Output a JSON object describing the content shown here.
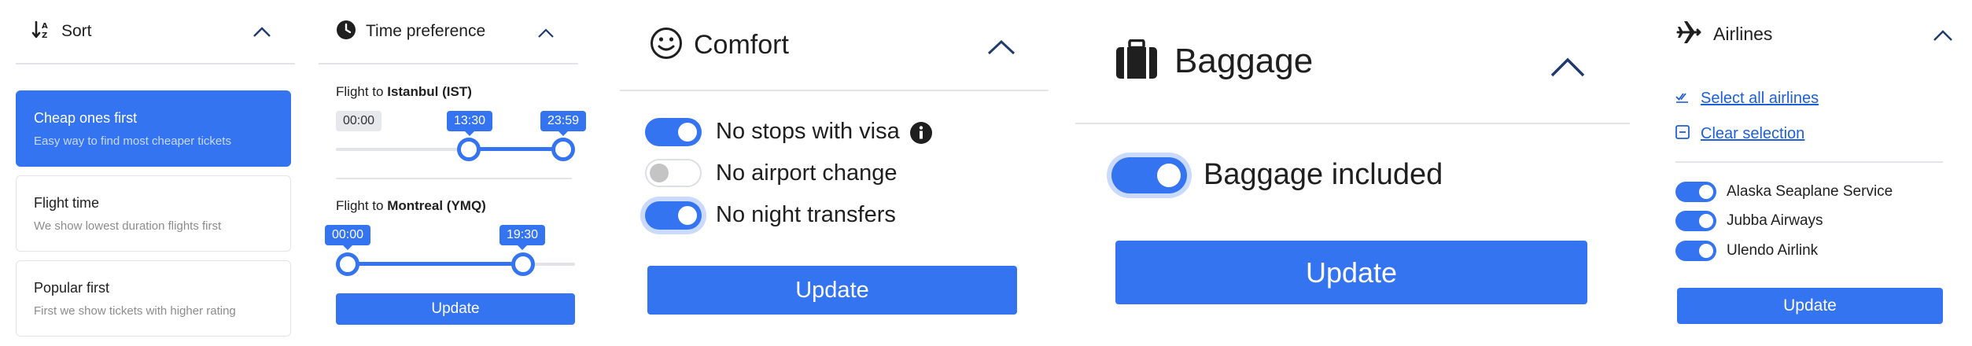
{
  "sort": {
    "title": "Sort",
    "options": [
      {
        "title": "Cheap ones first",
        "subtitle": "Easy way to find most cheaper tickets",
        "active": true
      },
      {
        "title": "Flight time",
        "subtitle": "We show lowest duration flights first",
        "active": false
      },
      {
        "title": "Popular first",
        "subtitle": "First we show tickets with higher rating",
        "active": false
      }
    ]
  },
  "time": {
    "title": "Time preference",
    "flights": [
      {
        "prefix": "Flight to",
        "city": "Istanbul (IST)",
        "min_label": "00:00",
        "low_label": "13:30",
        "high_label": "23:59",
        "low_fraction": 0.5625,
        "high_fraction": 1.0
      },
      {
        "prefix": "Flight to",
        "city": "Montreal (YMQ)",
        "low_label": "00:00",
        "high_label": "19:30",
        "low_fraction": 0.0,
        "high_fraction": 0.8125
      }
    ],
    "update_label": "Update"
  },
  "comfort": {
    "title": "Comfort",
    "options": [
      {
        "label": "No stops with visa",
        "on": true,
        "info": true
      },
      {
        "label": "No airport change",
        "on": false
      },
      {
        "label": "No night transfers",
        "on": true,
        "focused": true
      }
    ],
    "update_label": "Update"
  },
  "baggage": {
    "title": "Baggage",
    "option": {
      "label": "Baggage included",
      "on": true,
      "focused": true
    },
    "update_label": "Update"
  },
  "airlines": {
    "title": "Airlines",
    "select_all": "Select all airlines",
    "clear": "Clear selection",
    "items": [
      {
        "label": "Alaska Seaplane Service",
        "on": true
      },
      {
        "label": "Jubba Airways",
        "on": true
      },
      {
        "label": "Ulendo Airlink",
        "on": true
      }
    ],
    "update_label": "Update"
  },
  "colors": {
    "accent": "#3574f0",
    "border": "#e2e4e8",
    "muted": "#8c8c8c"
  }
}
